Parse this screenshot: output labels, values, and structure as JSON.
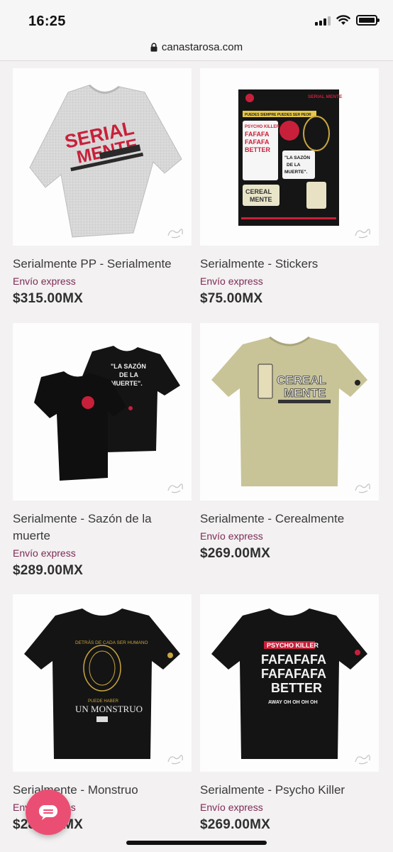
{
  "status_bar": {
    "time": "16:25"
  },
  "browser": {
    "url": "canastarosa.com"
  },
  "products": [
    {
      "name": "Serialmente PP - Serialmente",
      "shipping": "Envío express",
      "price": "$315.00MX",
      "print": {
        "line1": "SERIAL",
        "line2": "MENTE"
      }
    },
    {
      "name": "Serialmente - Stickers",
      "shipping": "Envío express",
      "price": "$75.00MX",
      "print": {
        "header": "SERIAL MENTE",
        "tape": "PUEDES SIEMPRE PUEDES SER PEOR",
        "psycho": "PSYCHO KILLER",
        "fa1": "FAFAFA",
        "fa2": "FAFAFA",
        "better": "BETTER",
        "sazon1": "\"LA SAZÓN",
        "sazon2": "DE LA",
        "sazon3": "MUERTE\".",
        "cereal1": "CEREAL",
        "cereal2": "MENTE"
      }
    },
    {
      "name": "Serialmente - Sazón de la muerte",
      "shipping": "Envío express",
      "price": "$289.00MX",
      "print": {
        "line1": "\"LA SAZÓN",
        "line2": "DE LA",
        "line3": "MUERTE\"."
      }
    },
    {
      "name": "Serialmente - Cerealmente",
      "shipping": "Envío express",
      "price": "$269.00MX",
      "print": {
        "line1": "CEREAL",
        "line2": "MENTE"
      }
    },
    {
      "name": "Serialmente - Monstruo",
      "shipping": "Envío express",
      "price": "$289.00MX",
      "print": {
        "arc": "DETRÁS DE CADA SER HUMANO",
        "small": "PUEDE HABER",
        "big": "UN MONSTRUO"
      }
    },
    {
      "name": "Serialmente - Psycho Killer",
      "shipping": "Envío express",
      "price": "$269.00MX",
      "print": {
        "title": "PSYCHO KILLER",
        "fa1": "FAFAFAFA",
        "fa2": "FAFAFAFA",
        "better": "BETTER",
        "away": "AWAY OH OH OH OH"
      }
    }
  ],
  "colors": {
    "accent": "#7c2a56",
    "chat_button": "#ea4f73"
  },
  "icons": {
    "chat": "chat-bubble-icon",
    "lock": "lock-icon",
    "wifi": "wifi-icon",
    "battery": "battery-icon",
    "signal": "signal-icon"
  }
}
